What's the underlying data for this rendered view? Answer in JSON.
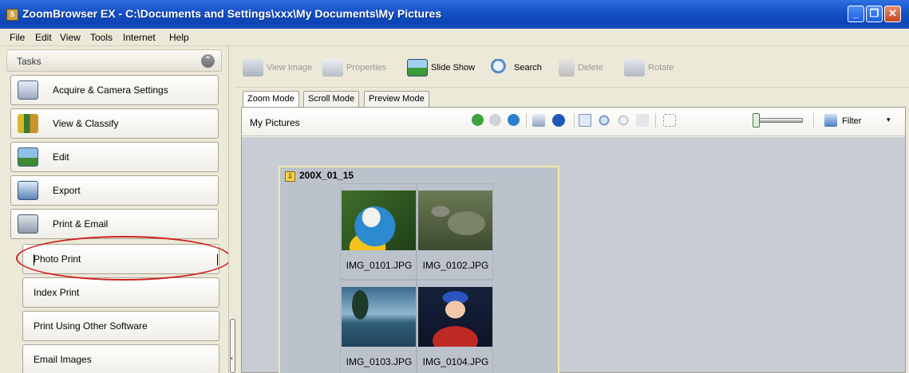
{
  "window": {
    "title": "ZoomBrowser EX  -  C:\\Documents and Settings\\xxx\\My Documents\\My Pictures",
    "icon_text": "5",
    "minimize": "_",
    "maximize": "❐",
    "close": "✕"
  },
  "menu": [
    "File",
    "Edit",
    "View",
    "Tools",
    "Internet",
    "Help"
  ],
  "tasks": {
    "title": "Tasks",
    "collapse_glyph": "⌃",
    "items": [
      {
        "label": "Acquire & Camera Settings",
        "icon": "camera-icon"
      },
      {
        "label": "View & Classify",
        "icon": "books-icon"
      },
      {
        "label": "Edit",
        "icon": "edit-picture-icon"
      },
      {
        "label": "Export",
        "icon": "export-icon"
      },
      {
        "label": "Print & Email",
        "icon": "printer-icon"
      }
    ],
    "sub_items": [
      "Photo Print",
      "Index Print",
      "Print Using Other Software",
      "Email Images"
    ],
    "splitter_arrow": "‹"
  },
  "toolbar": {
    "view_image": "View Image",
    "properties": "Properties",
    "slide_show": "Slide Show",
    "search": "Search",
    "delete": "Delete",
    "rotate": "Rotate"
  },
  "tabs": [
    "Zoom Mode",
    "Scroll Mode",
    "Preview Mode"
  ],
  "path_label": "My Pictures",
  "filter": {
    "label": "Filter",
    "arrow": "▾"
  },
  "group": {
    "title": "200X_01_15",
    "arrow": "⇩",
    "images": [
      "IMG_0101.JPG",
      "IMG_0102.JPG",
      "IMG_0103.JPG",
      "IMG_0104.JPG"
    ]
  },
  "colors": {
    "titlebar": "#0d44b5",
    "highlight_ellipse": "#d02020"
  }
}
